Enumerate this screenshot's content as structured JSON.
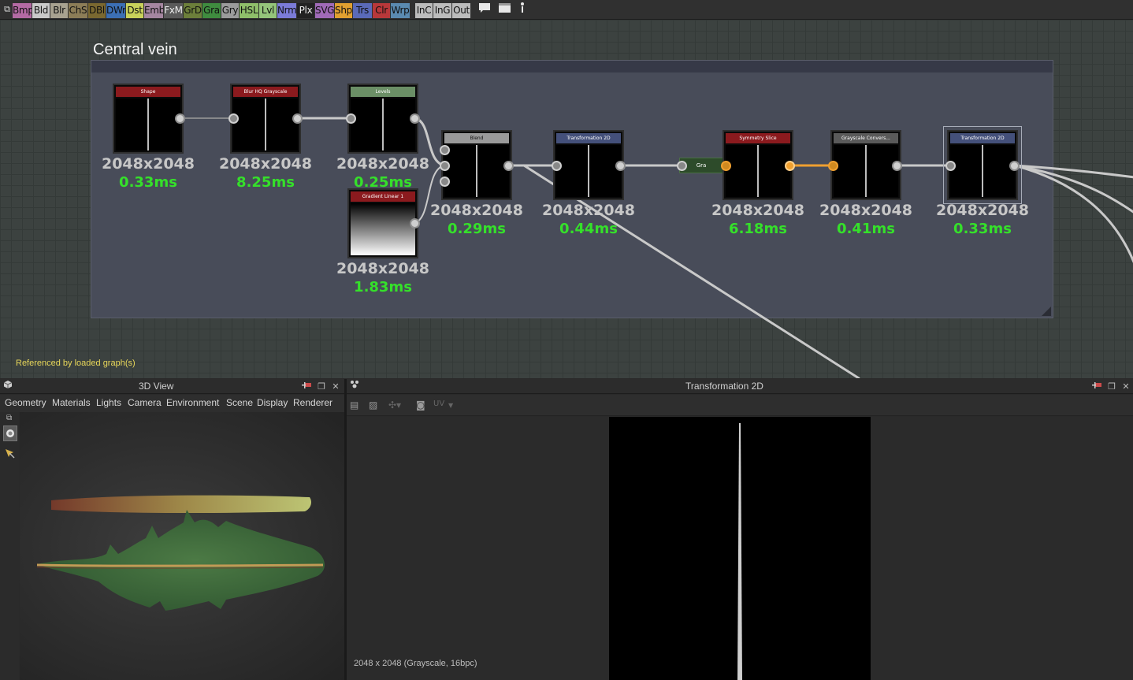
{
  "toolbar": {
    "filters": [
      {
        "label": "Bmp",
        "color": "#b46aa4"
      },
      {
        "label": "Bld",
        "color": "#c9c9c9"
      },
      {
        "label": "Blr",
        "color": "#a8a290"
      },
      {
        "label": "ChS",
        "color": "#8c7d57"
      },
      {
        "label": "DBl",
        "color": "#7a6830"
      },
      {
        "label": "DWr",
        "color": "#3c6fb4"
      },
      {
        "label": "Dst",
        "color": "#c9d15a"
      },
      {
        "label": "Emb",
        "color": "#a586a0"
      },
      {
        "label": "FxM",
        "color": "#5a5a5a"
      },
      {
        "label": "GrD",
        "color": "#6c7f3a"
      },
      {
        "label": "Gra",
        "color": "#3f8c3f"
      },
      {
        "label": "Gry",
        "color": "#9b9b9b"
      },
      {
        "label": "HSL",
        "color": "#8fbf6a"
      },
      {
        "label": "Lvl",
        "color": "#94c47a"
      },
      {
        "label": "Nrm",
        "color": "#7b7bd8"
      },
      {
        "label": "Plx",
        "color": "#222222"
      },
      {
        "label": "SVG",
        "color": "#a06ab8"
      },
      {
        "label": "Shp",
        "color": "#e0a030"
      },
      {
        "label": "Trs",
        "color": "#5a6ab8"
      },
      {
        "label": "Clr",
        "color": "#b8383a"
      },
      {
        "label": "Wrp",
        "color": "#5a8ab0"
      },
      {
        "label": "InC",
        "color": "#bcbcbc"
      },
      {
        "label": "InG",
        "color": "#bcbcbc"
      },
      {
        "label": "Out",
        "color": "#bcbcbc"
      }
    ],
    "icons": [
      "comment-icon",
      "frame-icon",
      "pin-icon"
    ]
  },
  "graph": {
    "frame_title": "Central vein",
    "referenced_text": "Referenced by loaded graph(s)",
    "nodes": [
      {
        "id": "shape",
        "title": "Shape",
        "title_color": "#8b1a1e",
        "resolution": "2048x2048",
        "time": "0.33ms"
      },
      {
        "id": "blur",
        "title": "Blur HQ Grayscale",
        "title_color": "#8b1a1e",
        "resolution": "2048x2048",
        "time": "8.25ms"
      },
      {
        "id": "levels",
        "title": "Levels",
        "title_color": "#6b8f66",
        "resolution": "2048x2048",
        "time": "0.25ms"
      },
      {
        "id": "gradient",
        "title": "Gradient Linear 1",
        "title_color": "#8b1a1e",
        "resolution": "2048x2048",
        "time": "1.83ms"
      },
      {
        "id": "blend",
        "title": "Blend",
        "title_color": "#9a9a9a",
        "resolution": "2048x2048",
        "time": "0.29ms"
      },
      {
        "id": "transform1",
        "title": "Transformation 2D",
        "title_color": "#44507a",
        "resolution": "2048x2048",
        "time": "0.44ms"
      },
      {
        "id": "symmetry",
        "title": "Symmetry Slice",
        "title_color": "#8b1a1e",
        "resolution": "2048x2048",
        "time": "6.18ms"
      },
      {
        "id": "grayscale",
        "title": "Grayscale Convers...",
        "title_color": "#5a5a5a",
        "resolution": "2048x2048",
        "time": "0.41ms"
      },
      {
        "id": "transform2",
        "title": "Transformation 2D",
        "title_color": "#44507a",
        "resolution": "2048x2048",
        "time": "0.33ms"
      }
    ],
    "mini_node_label": "Gra"
  },
  "view3d": {
    "title": "3D View",
    "menu": [
      "Geometry",
      "Materials",
      "Lights",
      "Camera",
      "Environment",
      "Scene",
      "Display",
      "Renderer"
    ]
  },
  "view2d": {
    "title": "Transformation 2D",
    "uv_label": "UV",
    "info": "2048 x 2048 (Grayscale, 16bpc)"
  }
}
